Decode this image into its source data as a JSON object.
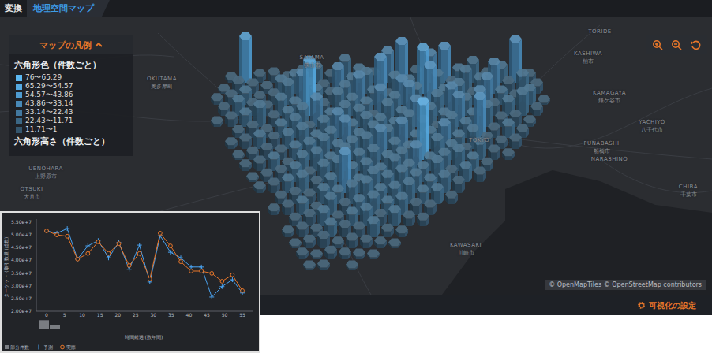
{
  "header": {
    "section": "変換",
    "tabs": [
      {
        "label": "地理空間マップ",
        "selected": true
      }
    ]
  },
  "legend": {
    "title": "マップの凡例",
    "expanded": true,
    "color_title": "六角形色（件数ごと）",
    "items": [
      {
        "label": "76〜65.29",
        "color": "#5cb8f2"
      },
      {
        "label": "65.29〜54.57",
        "color": "#55aae2"
      },
      {
        "label": "54.57〜43.86",
        "color": "#4e9bd0"
      },
      {
        "label": "43.86〜33.14",
        "color": "#4889b8"
      },
      {
        "label": "33.14〜22.43",
        "color": "#42789f"
      },
      {
        "label": "22.43〜11.71",
        "color": "#3b6785"
      },
      {
        "label": "11.71〜1",
        "color": "#34566e"
      }
    ],
    "height_title": "六角形高さ（件数ごと）"
  },
  "map": {
    "labels": [
      "TORIDE",
      "SAYAMA",
      "狭山市",
      "KASHIWA",
      "柏市",
      "OKUTAMA",
      "奥多摩町",
      "KAMAGAYA",
      "鎌ケ谷市",
      "YACHIYO",
      "八千代市",
      "FUNABASHI",
      "船橋市",
      "NARASHINO",
      "CHIBA",
      "千葉市",
      "TOKYO",
      "KAWASAKI",
      "川崎市",
      "UENOHARA",
      "上野原市",
      "OTSUKI",
      "大月市"
    ],
    "attribution": "© OpenMapTiles © OpenStreetMap contributors",
    "hexbins": {
      "rows": [
        [
          0,
          3,
          45,
          6,
          8,
          4,
          10,
          14,
          6,
          22,
          12,
          8,
          30,
          40,
          10,
          28,
          35,
          12,
          20,
          8,
          15,
          42,
          6,
          0
        ],
        [
          2,
          10,
          8,
          5,
          12,
          18,
          9,
          7,
          25,
          14,
          20,
          35,
          16,
          12,
          45,
          18,
          10,
          22,
          14,
          30,
          10,
          18,
          8,
          0
        ],
        [
          4,
          8,
          12,
          6,
          9,
          20,
          30,
          14,
          10,
          18,
          28,
          12,
          9,
          24,
          16,
          38,
          14,
          20,
          10,
          26,
          12,
          8,
          14,
          2
        ],
        [
          6,
          14,
          10,
          8,
          16,
          12,
          55,
          10,
          22,
          16,
          12,
          26,
          18,
          30,
          12,
          20,
          28,
          16,
          24,
          10,
          14,
          22,
          6,
          0
        ],
        [
          3,
          8,
          12,
          20,
          9,
          14,
          18,
          28,
          12,
          20,
          16,
          10,
          22,
          14,
          26,
          18,
          12,
          30,
          12,
          20,
          8,
          10,
          4,
          0
        ],
        [
          0,
          5,
          10,
          6,
          12,
          18,
          10,
          16,
          24,
          12,
          20,
          18,
          14,
          22,
          16,
          10,
          20,
          14,
          40,
          8,
          12,
          6,
          0,
          0
        ],
        [
          0,
          4,
          8,
          12,
          10,
          14,
          20,
          12,
          16,
          28,
          14,
          22,
          18,
          26,
          12,
          16,
          24,
          12,
          18,
          10,
          6,
          8,
          0,
          0
        ],
        [
          0,
          2,
          6,
          10,
          8,
          12,
          16,
          20,
          14,
          18,
          22,
          30,
          16,
          12,
          58,
          20,
          14,
          10,
          16,
          8,
          4,
          0,
          0,
          0
        ],
        [
          0,
          0,
          4,
          8,
          12,
          6,
          14,
          18,
          12,
          22,
          16,
          20,
          14,
          18,
          24,
          12,
          16,
          20,
          12,
          6,
          0,
          0,
          0,
          0
        ],
        [
          0,
          0,
          2,
          6,
          10,
          14,
          8,
          16,
          20,
          14,
          18,
          12,
          22,
          16,
          14,
          20,
          10,
          14,
          8,
          0,
          0,
          0,
          0,
          0
        ],
        [
          0,
          0,
          0,
          4,
          8,
          12,
          16,
          10,
          14,
          40,
          12,
          20,
          16,
          22,
          18,
          12,
          16,
          10,
          0,
          0,
          0,
          0,
          0,
          0
        ],
        [
          0,
          0,
          0,
          0,
          6,
          10,
          8,
          14,
          12,
          18,
          22,
          14,
          16,
          20,
          12,
          14,
          6,
          0,
          0,
          0,
          0,
          0,
          0,
          0
        ],
        [
          0,
          0,
          0,
          0,
          4,
          8,
          12,
          6,
          16,
          10,
          14,
          18,
          12,
          16,
          10,
          8,
          0,
          0,
          0,
          0,
          0,
          0,
          0,
          0
        ],
        [
          0,
          0,
          0,
          0,
          0,
          6,
          10,
          14,
          8,
          12,
          16,
          10,
          14,
          8,
          6,
          0,
          0,
          0,
          0,
          0,
          0,
          0,
          0,
          0
        ],
        [
          0,
          0,
          0,
          0,
          0,
          4,
          8,
          6,
          12,
          10,
          8,
          14,
          6,
          4,
          0,
          0,
          0,
          0,
          0,
          0,
          0,
          0,
          0,
          0
        ],
        [
          0,
          0,
          0,
          0,
          0,
          2,
          6,
          10,
          4,
          8,
          6,
          4,
          2,
          0,
          0,
          0,
          0,
          0,
          0,
          0,
          0,
          0,
          0,
          0
        ],
        [
          0,
          0,
          0,
          0,
          0,
          0,
          4,
          2,
          6,
          4,
          3,
          2,
          0,
          0,
          0,
          0,
          0,
          0,
          0,
          0,
          0,
          0,
          0,
          0
        ],
        [
          0,
          0,
          0,
          0,
          0,
          0,
          2,
          3,
          0,
          2,
          0,
          0,
          0,
          0,
          0,
          0,
          0,
          0,
          0,
          0,
          0,
          0,
          0,
          0
        ]
      ]
    }
  },
  "footer": {
    "settings": "可視化の設定"
  },
  "chart": {
    "y_title": "ターゲット (取引数量 (総数))",
    "x_title": "時間経過 (数年間)",
    "y_ticks": [
      "5.50e+7",
      "5.00e+7",
      "4.50e+7",
      "4.00e+7",
      "3.50e+7",
      "3.00e+7",
      "2.50e+7",
      "2.00e+7"
    ],
    "x_ticks": [
      "0",
      "5",
      "10",
      "15",
      "20",
      "25",
      "30",
      "35",
      "40",
      "45",
      "50",
      "55"
    ],
    "x": [
      0,
      2.9,
      5.8,
      8.7,
      11.6,
      14.5,
      17.4,
      20.3,
      23.2,
      26.1,
      29,
      31.9,
      34.8,
      37.7,
      40.6,
      43.5,
      46.4,
      49.3,
      52.2,
      55
    ],
    "histogram": {
      "name": "部分件数",
      "values": [
        9,
        4
      ]
    },
    "series": [
      {
        "name": "予測",
        "color": "#4aa3f0",
        "values": [
          51600000,
          50700000,
          52500000,
          40500000,
          45700000,
          47800000,
          41000000,
          47000000,
          36500000,
          46000000,
          31500000,
          49700000,
          43200000,
          41000000,
          37400000,
          37400000,
          25600000,
          29700000,
          32400000,
          27200000
        ]
      },
      {
        "name": "実際",
        "color": "#e8772a",
        "values": [
          51600000,
          50000000,
          49500000,
          40500000,
          42700000,
          47300000,
          42700000,
          46600000,
          38000000,
          42700000,
          32700000,
          50700000,
          45700000,
          39500000,
          35800000,
          35800000,
          34900000,
          31800000,
          34300000,
          28100000
        ]
      }
    ]
  }
}
